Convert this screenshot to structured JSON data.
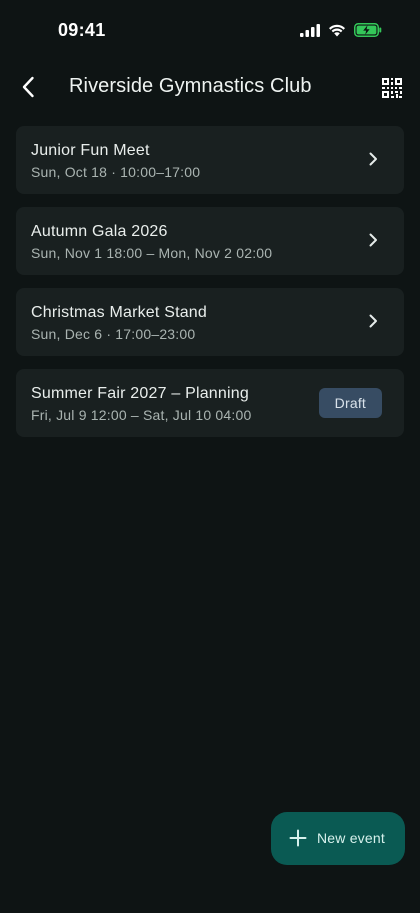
{
  "status_bar": {
    "time": "09:41"
  },
  "header": {
    "title": "Riverside Gymnastics Club"
  },
  "events": [
    {
      "title": "Junior Fun Meet",
      "date": "Sun, Oct 18 · 10:00–17:00",
      "badge": null
    },
    {
      "title": "Autumn Gala 2026",
      "date": "Sun, Nov 1 18:00 – Mon, Nov 2 02:00",
      "badge": null
    },
    {
      "title": "Christmas Market Stand",
      "date": "Sun, Dec 6 · 17:00–23:00",
      "badge": null
    },
    {
      "title": "Summer Fair 2027 – Planning",
      "date": "Fri, Jul 9 12:00 – Sat, Jul 10 04:00",
      "badge": "Draft"
    }
  ],
  "fab": {
    "label": "New event"
  },
  "colors": {
    "background": "#0e1414",
    "card": "#192020",
    "fab": "#0a5a53",
    "draft_badge": "#374c63",
    "battery_green": "#34c759"
  }
}
